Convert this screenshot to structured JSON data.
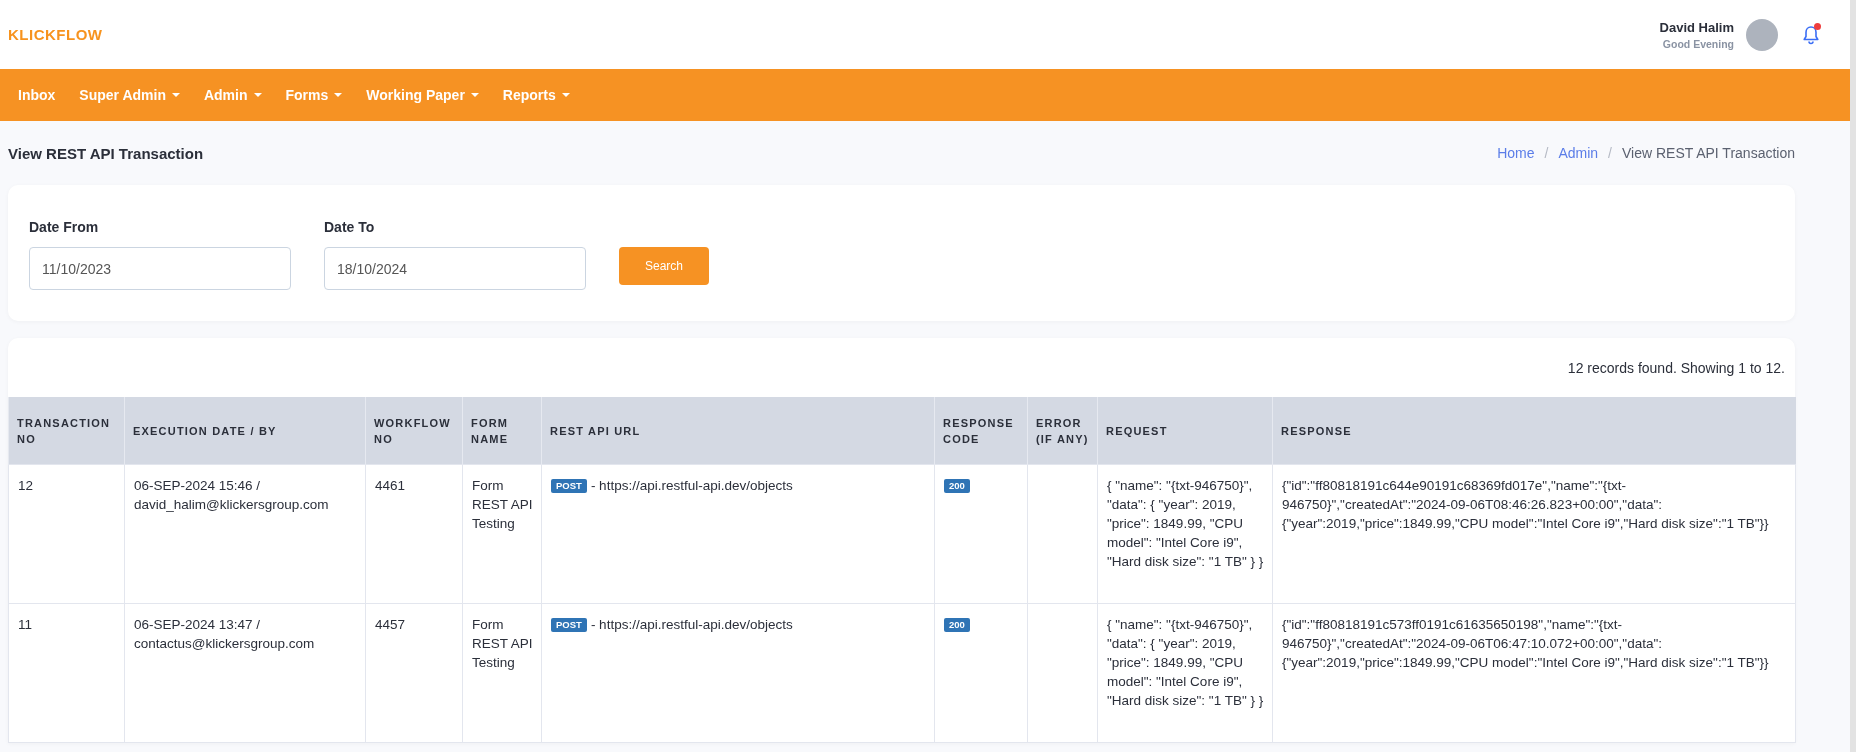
{
  "brand": "KLICKFLOW",
  "user": {
    "name": "David Halim",
    "greeting": "Good Evening",
    "has_notification": true
  },
  "nav": [
    {
      "label": "Inbox",
      "dropdown": false
    },
    {
      "label": "Super Admin",
      "dropdown": true
    },
    {
      "label": "Admin",
      "dropdown": true
    },
    {
      "label": "Forms",
      "dropdown": true
    },
    {
      "label": "Working Paper",
      "dropdown": true
    },
    {
      "label": "Reports",
      "dropdown": true
    }
  ],
  "page_title": "View REST API Transaction",
  "breadcrumb": [
    {
      "label": "Home",
      "link": true
    },
    {
      "separator": "/",
      "label": "Admin",
      "link": true
    },
    {
      "separator": "/",
      "label": "View REST API Transaction",
      "link": false
    }
  ],
  "filters": [
    {
      "label": "Date From",
      "value": "11/10/2023"
    },
    {
      "label": "Date To",
      "value": "18/10/2024"
    }
  ],
  "search_button": "Search",
  "records_summary": "12 records found. Showing 1 to 12.",
  "table": {
    "columns": [
      "TRANSACTION NO",
      "EXECUTION DATE / BY",
      "WORKFLOW NO",
      "FORM NAME",
      "REST API URL",
      "RESPONSE CODE",
      "ERROR (IF ANY)",
      "REQUEST",
      "RESPONSE"
    ],
    "rows": [
      {
        "transaction_no": "12",
        "execution": "06-SEP-2024 15:46 / david_halim@klickersgroup.com",
        "workflow_no": "4461",
        "form_name": "Form REST API Testing",
        "method": "POST",
        "url": "- https://api.restful-api.dev/objects",
        "response_code": "200",
        "request": "{ \"name\": \"{txt-946750}\", \"data\": { \"year\": 2019, \"price\": 1849.99, \"CPU model\": \"Intel Core i9\", \"Hard disk size\": \"1 TB\" } }",
        "response": "{\"id\":\"ff80818191c644e90191c68369fd017e\",\"name\":\"{txt-946750}\",\"createdAt\":\"2024-09-06T08:46:26.823+00:00\",\"data\":{\"year\":2019,\"price\":1849.99,\"CPU model\":\"Intel Core i9\",\"Hard disk size\":\"1 TB\"}}"
      },
      {
        "transaction_no": "11",
        "execution": "06-SEP-2024 13:47 / contactus@klickersgroup.com",
        "workflow_no": "4457",
        "form_name": "Form REST API Testing",
        "method": "POST",
        "url": "- https://api.restful-api.dev/objects",
        "response_code": "200",
        "request": "{ \"name\": \"{txt-946750}\", \"data\": { \"year\": 2019, \"price\": 1849.99, \"CPU model\": \"Intel Core i9\", \"Hard disk size\": \"1 TB\" } }",
        "response": "{\"id\":\"ff80818191c573ff0191c61635650198\",\"name\":\"{txt-946750}\",\"createdAt\":\"2024-09-06T06:47:10.072+00:00\",\"data\":{\"year\":2019,\"price\":1849.99,\"CPU model\":\"Intel Core i9\",\"Hard disk size\":\"1 TB\"}}"
      }
    ]
  }
}
